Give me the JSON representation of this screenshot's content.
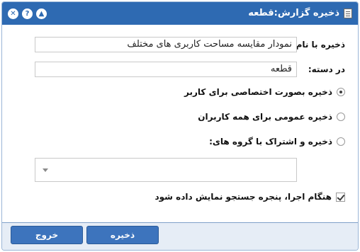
{
  "dialog": {
    "title": "ذخیره گزارش:قطعه",
    "icons": {
      "title": "report-icon",
      "close": "close-icon",
      "help": "help-icon",
      "collapse": "collapse-icon"
    },
    "close_glyph": "✕",
    "help_glyph": "?",
    "collapse_glyph": "▲"
  },
  "form": {
    "name_label": "ذخیره با نام:",
    "name_value": "نمودار مقایسه مساحت کاربری های مختلف",
    "category_label": "در دسته:",
    "category_value": "قطعه",
    "options": [
      {
        "label": "ذخیره بصورت اختصاصی برای کاربر",
        "checked": true
      },
      {
        "label": "ذخیره عمومی برای همه کاربران",
        "checked": false
      },
      {
        "label": "ذخیره و اشتراک با گروه های:",
        "checked": false
      }
    ],
    "group_select_value": "",
    "show_search_label": "هنگام اجرا، پنجره جستجو نمایش داده شود",
    "show_search_checked": true
  },
  "buttons": {
    "save": "ذخیره",
    "exit": "خروج"
  },
  "colors": {
    "titlebar": "#2e6ab2",
    "button": "#3d74bd",
    "footer": "#e6edf6"
  }
}
